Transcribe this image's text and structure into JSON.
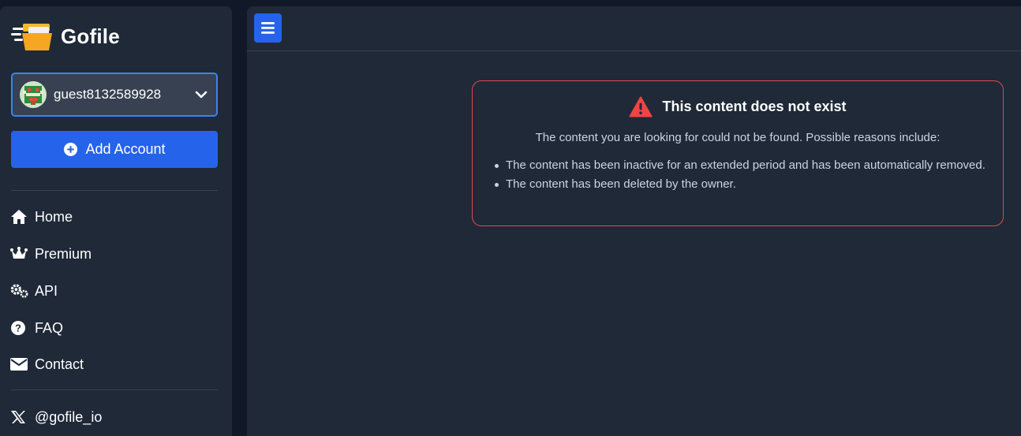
{
  "brand": {
    "name": "Gofile",
    "logo_icon": "folder-speed-logo"
  },
  "account": {
    "username": "guest8132589928",
    "avatar_icon": "pixel-avatar",
    "dropdown_icon": "chevron-down-icon"
  },
  "add_account": {
    "label": "Add Account",
    "icon": "plus-circle-icon"
  },
  "nav": {
    "items": [
      {
        "label": "Home",
        "icon": "home-icon"
      },
      {
        "label": "Premium",
        "icon": "crown-icon"
      },
      {
        "label": "API",
        "icon": "gears-icon"
      },
      {
        "label": "FAQ",
        "icon": "question-circle-icon"
      },
      {
        "label": "Contact",
        "icon": "envelope-icon"
      }
    ],
    "social": {
      "label": "@gofile_io",
      "icon": "x-logo-icon"
    }
  },
  "topbar": {
    "menu_icon": "hamburger-menu-icon"
  },
  "alert": {
    "title": "This content does not exist",
    "icon": "warning-triangle-icon",
    "description": "The content you are looking for could not be found. Possible reasons include:",
    "reasons": [
      "The content has been inactive for an extended period and has been automatically removed.",
      "The content has been deleted by the owner."
    ]
  },
  "colors": {
    "background": "#111827",
    "panel": "#1f2937",
    "accent": "#2563eb",
    "select_border": "#3b82f6",
    "alert_border": "#dc4a55",
    "warning_icon": "#ef4444",
    "muted_text": "#cbd5e1"
  }
}
